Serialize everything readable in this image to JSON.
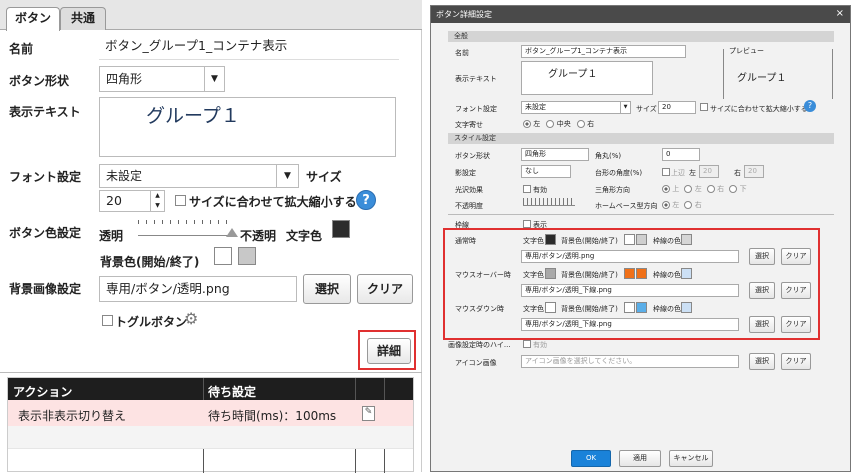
{
  "left": {
    "tabs": [
      "ボタン",
      "共通"
    ],
    "name": {
      "label": "名前",
      "value": "ボタン_グループ1_コンテナ表示"
    },
    "shape": {
      "label": "ボタン形状",
      "value": "四角形"
    },
    "display_text": {
      "label": "表示テキスト",
      "value": "グループ１"
    },
    "font": {
      "label": "フォント設定",
      "value": "未設定",
      "size_label": "サイズ",
      "size_value": "20",
      "fit_label": "サイズに合わせて拡大縮小する"
    },
    "color": {
      "label": "ボタン色設定",
      "transparent": "透明",
      "opaque": "不透明",
      "text_color": "文字色",
      "bg_label": "背景色(開始/終了)"
    },
    "bg_image": {
      "label": "背景画像設定",
      "value": "専用/ボタン/透明.png",
      "select": "選択",
      "clear": "クリア"
    },
    "toggle": {
      "label": "トグルボタン"
    },
    "detail_button": "詳細",
    "action_table": {
      "headers": [
        "アクション",
        "待ち設定"
      ],
      "rows": [
        {
          "action": "表示非表示切り替え",
          "wait": "待ち時間(ms)：100ms"
        }
      ]
    },
    "colors": {
      "text": "#2c2c2c",
      "bg_end": "#c8c8c8",
      "highlight": "#e03030",
      "row": "#fde3e3"
    }
  },
  "dialog": {
    "title": "ボタン詳細設定",
    "close": "×",
    "sections": {
      "general": "全般",
      "style": "スタイル設定"
    },
    "name_label": "名前",
    "name_value": "ボタン_グループ1_コンテナ表示",
    "text_label": "表示テキスト",
    "text_value": "グループ１",
    "preview_label": "プレビュー",
    "preview_text": "グループ１",
    "font_label": "フォント設定",
    "font_value": "未設定",
    "size_label": "サイズ",
    "size_value": "20",
    "fit_label": "サイズに合わせて拡大縮小する",
    "align_label": "文字寄せ",
    "align_options": [
      "左",
      "中央",
      "右"
    ],
    "shape_label": "ボタン形状",
    "shape_value": "四角形",
    "corner_label": "角丸(%)",
    "corner_value": "0",
    "shadow_label": "影設定",
    "shadow_value": "なし",
    "trap_label": "台形の角度(%)",
    "up_label": "上辺",
    "left_label": "左",
    "left_value": "20",
    "right_label": "右",
    "right_value": "20",
    "gloss_label": "光沢効果",
    "gloss_check": "有効",
    "tri_label": "三角形方向",
    "tri_options": [
      "上",
      "左",
      "右",
      "下"
    ],
    "opacity_label": "不透明度",
    "home_label": "ホームベース型方向",
    "home_options": [
      "左",
      "右"
    ],
    "border_label": "枠線",
    "border_check": "表示",
    "states": [
      {
        "label": "通常時",
        "text_color": "文字色",
        "bg": "背景色(開始/終了)",
        "border": "枠線の色",
        "file": "専用/ボタン/透明.png",
        "c1": "#2c2c2c",
        "c2": "#ffffff",
        "c3": "#cfcfcf",
        "c4": "#d6d6d6"
      },
      {
        "label": "マウスオーバー時",
        "text_color": "文字色",
        "bg": "背景色(開始/終了)",
        "border": "枠線の色",
        "file": "専用/ボタン/透明_下線.png",
        "c1": "#a9a9a9",
        "c2": "#f07018",
        "c3": "#f07018",
        "c4": "#cce0f5"
      },
      {
        "label": "マウスダウン時",
        "text_color": "文字色",
        "bg": "背景色(開始/終了)",
        "border": "枠線の色",
        "file": "専用/ボタン/透明_下線.png",
        "c1": "#ffffff",
        "c2": "#ffffff",
        "c3": "#5aaee8",
        "c4": "#cce0f5"
      }
    ],
    "select": "選択",
    "clear": "クリア",
    "image_disabled_label": "画像設定時のハイ...",
    "image_disabled_check": "有効",
    "icon_label": "アイコン画像",
    "icon_placeholder": "アイコン画像を選択してください。",
    "ok": "OK",
    "apply": "適用",
    "cancel": "キャンセル"
  }
}
